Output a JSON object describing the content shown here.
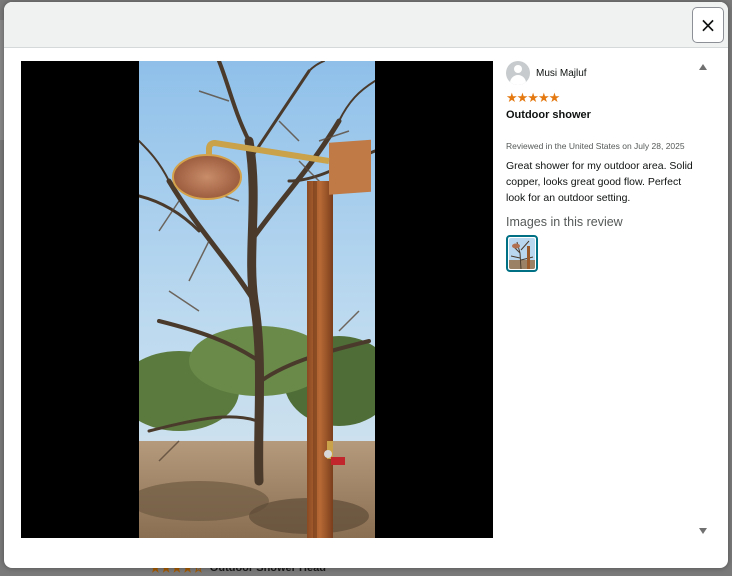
{
  "modal": {
    "close_icon": "×"
  },
  "review": {
    "reviewer_name": "Musi Majluf",
    "rating": 5,
    "rating_max": 5,
    "stars_text": "★★★★★",
    "title": "Outdoor shower",
    "date": "Reviewed in the United States on July 28, 2025",
    "body": "Great shower for my outdoor area. Solid copper, looks great good flow. Perfect look for an outdoor setting.",
    "images_heading": "Images in this review",
    "image_count": 1
  },
  "background": {
    "footer_stars": "★★★★☆",
    "footer_title": "Outdoor Shower Head"
  },
  "colors": {
    "star": "#e47911",
    "accent": "#007185",
    "viewer_bg": "#000000"
  },
  "icons": {
    "close": "close-icon",
    "avatar": "avatar-icon",
    "scroll_up": "scroll-up-arrow-icon",
    "scroll_down": "scroll-down-arrow-icon"
  }
}
